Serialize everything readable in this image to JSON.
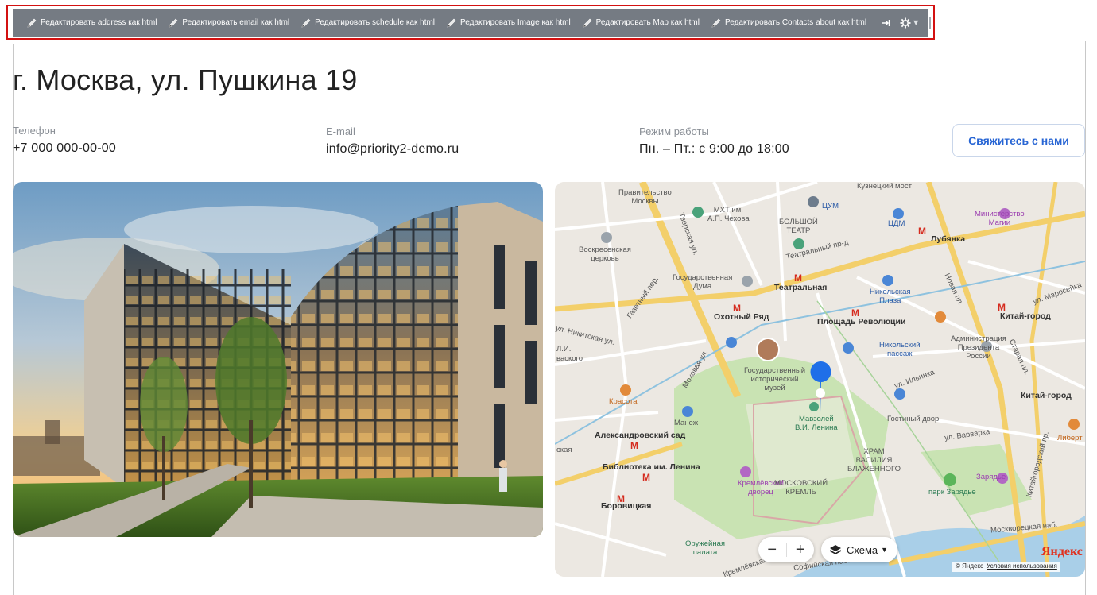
{
  "toolbar": {
    "buttons": [
      {
        "label": "Редактировать address как html"
      },
      {
        "label": "Редактировать email как html"
      },
      {
        "label": "Редактировать schedule как html"
      },
      {
        "label": "Редактировать Image как html"
      },
      {
        "label": "Редактировать Map как html"
      },
      {
        "label": "Редактировать Contacts about как html"
      }
    ],
    "icons": [
      "pin-icon",
      "gear-icon"
    ]
  },
  "page": {
    "title": "г. Москва, ул. Пушкина 19",
    "phone": {
      "label": "Телефон",
      "value": "+7 000 000-00-00"
    },
    "email": {
      "label": "E-mail",
      "value": "info@priority2-demo.ru"
    },
    "schedule": {
      "label": "Режим работы",
      "value": "Пн. – Пт.: с 9:00 до 18:00"
    },
    "contact_button": "Свяжитесь с нами"
  },
  "map": {
    "labels": {
      "kuznetsky": "Кузнецкий мост",
      "pravitelstvo": "Правительство\nМосквы",
      "mht": "МХТ им.\nА.П. Чехова",
      "bolshoi": "БОЛЬШОЙ\nТЕАТР",
      "tsum1": "ЦУМ",
      "tsum2": "ЦДМ",
      "ministry": "Министерство\nМагии",
      "lubyanka": "Лубянка",
      "voskresenskaya": "Воскресенская\nцерковь",
      "teatralny_pr": "Театральный пр-д",
      "duma": "Государственная\nДума",
      "teatralnaya": "Театральная",
      "nikolskaya_plaza": "Никольская\nПлаза",
      "okhotny": "Охотный Ряд",
      "pl_revolyutsii": "Площадь Революции",
      "kitay_gorod1": "Китай-город",
      "nikolsky_passage": "Никольский\nпассаж",
      "administration": "Администрация\nПрезидента\nРоссии",
      "museum": "Государственный\nисторический\nмузей",
      "krasota": "Красота",
      "manezh": "Манеж",
      "mausoleum": "Мавзолей\nВ.И. Ленина",
      "gostiny": "Гостиный двор",
      "kitay_gorod2": "Китай-город",
      "aleksandrovsky": "Александровский сад",
      "varvarka": "ул. Варварка",
      "biblioteka": "Библиотека им. Ленина",
      "vasily": "ХРАМ\nВАСИЛИЯ\nБЛАЖЕННОГО",
      "kremlin_palace": "Кремлёвский\nдворец",
      "moscow_kremlin": "МОСКОВСКИЙ\nКРЕМЛЬ",
      "zaryadye1": "Зарядье",
      "zaryadye2": "парк Зарядье",
      "borovitskaya": "Боровицкая",
      "oruzheinaya": "Оружейная\nпалата",
      "moskvoretskaya": "Москворецкая наб.",
      "tverskaya": "Тверская ул.",
      "mokhovaya": "Моховая ул.",
      "ilyinka": "ул. Ильинка",
      "nikitskaya": "ул. Никитская ул.",
      "sofiyskaya": "Софийская наб.",
      "kremlevskaya": "Кремлёвская наб.",
      "gazetny": "Газетный пер.",
      "novaya_pl": "Новая пл.",
      "staraya_pl": "Старая пл.",
      "kitaygorodsky": "Китайгородский пр.",
      "liberty": "Либерт",
      "skaya": "ская",
      "vasko": "ваского",
      "pi": "Л.И.",
      "maroseika": "ул. Маросейка"
    },
    "layer_button": "Схема",
    "zoom_out": "−",
    "zoom_in": "+",
    "logo": "Яндекс",
    "attribution": "© Яндекс",
    "terms_link": "Условия использования"
  },
  "colors": {
    "toolbar_bg": "#757b83",
    "highlight_border": "#d31111",
    "accent": "#2765d4",
    "metro_red": "#d52b1e"
  }
}
